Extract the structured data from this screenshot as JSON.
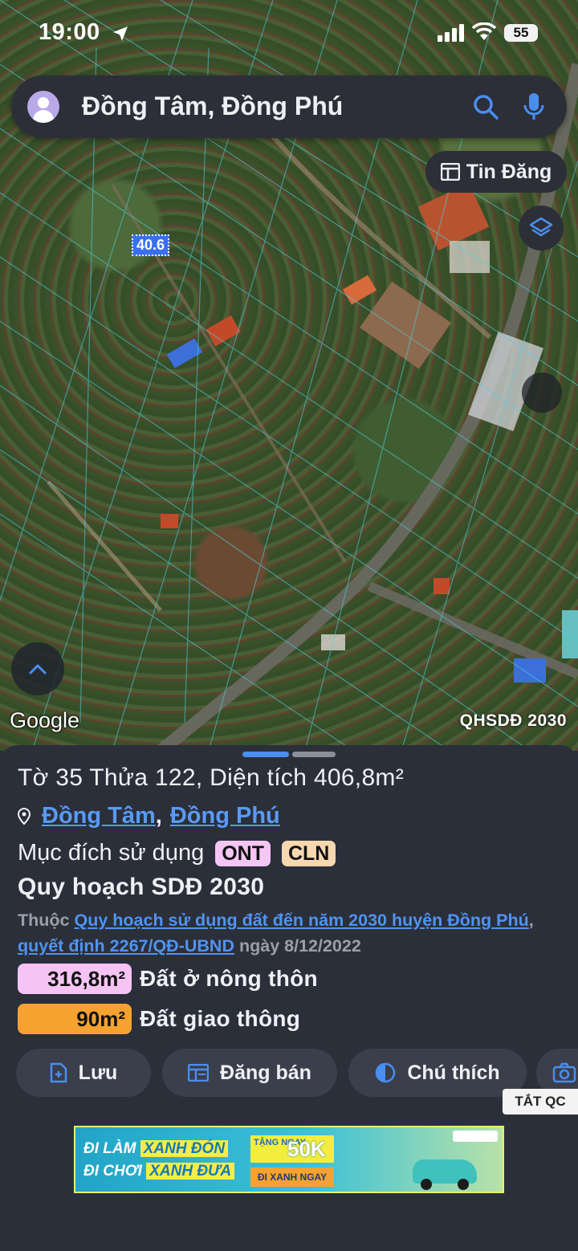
{
  "status_bar": {
    "time": "19:00",
    "battery": "55"
  },
  "search": {
    "query": "Đồng Tâm, Đồng Phú"
  },
  "map": {
    "tin_dang_label": "Tin Đăng",
    "parcel_label": "40.6",
    "google_label": "Google",
    "plan_label": "QHSDĐ 2030"
  },
  "parcel": {
    "title": "Tờ 35 Thửa 122, Diện tích 406,8m²",
    "commune": "Đồng Tâm",
    "district": "Đồng Phú",
    "separator": ",",
    "purpose_label": "Mục đích sử dụng",
    "purpose_codes": [
      "ONT",
      "CLN"
    ],
    "plan_title": "Quy hoạch SDĐ 2030",
    "belongs_prefix": "Thuộc",
    "plan_link": "Quy hoạch sử dụng đất đến năm 2030 huyện Đồng Phú",
    "decision_link": "quyết định 2267/QĐ-UBND",
    "date_text": "ngày 8/12/2022",
    "areas": [
      {
        "value": "316,8m²",
        "label": "Đất ở nông thôn",
        "color": "#f6c4f4"
      },
      {
        "value": "90m²",
        "label": "Đất giao thông",
        "color": "#f6a230"
      }
    ]
  },
  "actions": {
    "save": "Lưu",
    "sell": "Đăng bán",
    "legend": "Chú thích"
  },
  "ad": {
    "close_label": "TẮT QC",
    "line1_a": "ĐI LÀM",
    "line1_b": "XANH ĐÓN",
    "line2_a": "ĐI CHƠI",
    "line2_b": "XANH ĐƯA",
    "promo_small": "TẶNG NGAY",
    "promo_big": "50K",
    "cta": "ĐI XANH NGAY"
  },
  "colors": {
    "accent": "#4a8ef0",
    "link": "#5a9af5",
    "sheet_bg": "#2b2f3a"
  }
}
